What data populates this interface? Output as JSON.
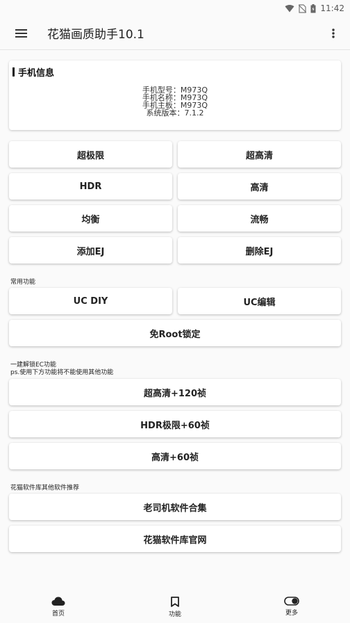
{
  "status_bar": {
    "time": "11:42"
  },
  "app_bar": {
    "title": "花猫画质助手10.1"
  },
  "phone_info": {
    "title": "手机信息",
    "lines": [
      "手机型号：M973Q",
      "手机名称：M973Q",
      "手机主板：M973Q",
      "系统版本：7.1.2"
    ]
  },
  "quality_buttons": {
    "ultra_limit": "超极限",
    "ultra_hd": "超高清",
    "hdr": "HDR",
    "hd": "高清",
    "balanced": "均衡",
    "smooth": "流畅",
    "add_ej": "添加EJ",
    "delete_ej": "删除EJ"
  },
  "common": {
    "label": "常用功能",
    "uc_diy": "UC DIY",
    "uc_edit": "UC编辑",
    "no_root_lock": "免Root锁定"
  },
  "unlock": {
    "label_line1": "一建解锁EC功能",
    "label_line2": "ps.使用下方功能将不能使用其他功能",
    "ultra_hd_120": "超高清+120祯",
    "hdr_limit_60": "HDR极限+60祯",
    "hd_60": "高清+60祯"
  },
  "recommend": {
    "label": "花猫软件库其他软件推荐",
    "driver_collection": "老司机软件合集",
    "official_site": "花猫软件库官网"
  },
  "bottom_nav": {
    "home": "首页",
    "functions": "功能",
    "more": "更多"
  }
}
